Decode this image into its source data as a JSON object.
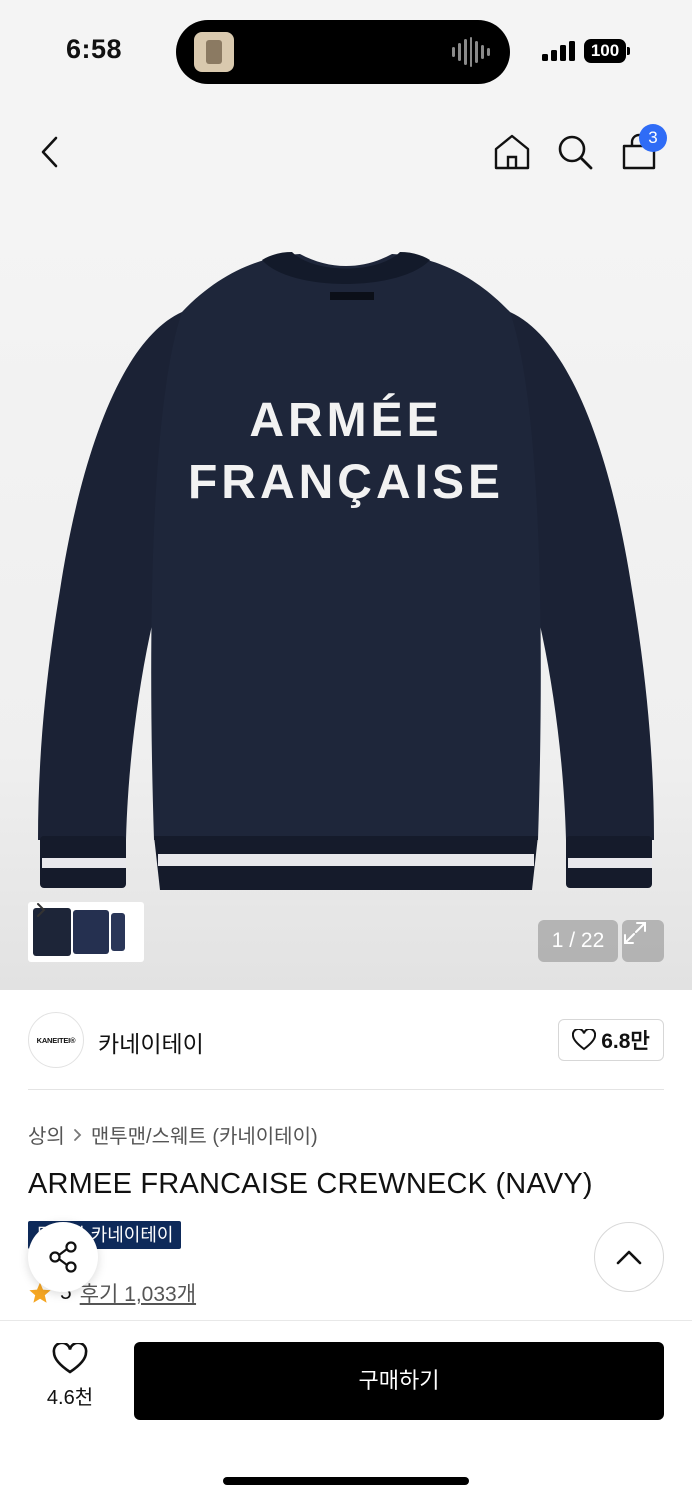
{
  "status_bar": {
    "time": "6:58",
    "battery": "100"
  },
  "header": {
    "cart_count": "3"
  },
  "hero": {
    "print_line1": "ARMÉE",
    "print_line2": "FRANÇAISE",
    "counter": "1 / 22"
  },
  "brand": {
    "logo_text": "KANEITEI®",
    "name": "카네이테이",
    "likes": "6.8만"
  },
  "breadcrumb": {
    "category": "상의",
    "subcategory": "맨투맨/스웨트 (카네이테이)"
  },
  "product": {
    "title": "ARMEE FRANCAISE CREWNECK (NAVY)",
    "tag": "무신사 카네이테이",
    "rating": "5",
    "reviews": "후기 1,033개"
  },
  "bottom_bar": {
    "wish_count": "4.6천",
    "buy_label": "구매하기"
  },
  "colors": {
    "accent": "#2f6cf6",
    "garment": "#1b2235",
    "tag_bg": "#0e2a5a"
  }
}
